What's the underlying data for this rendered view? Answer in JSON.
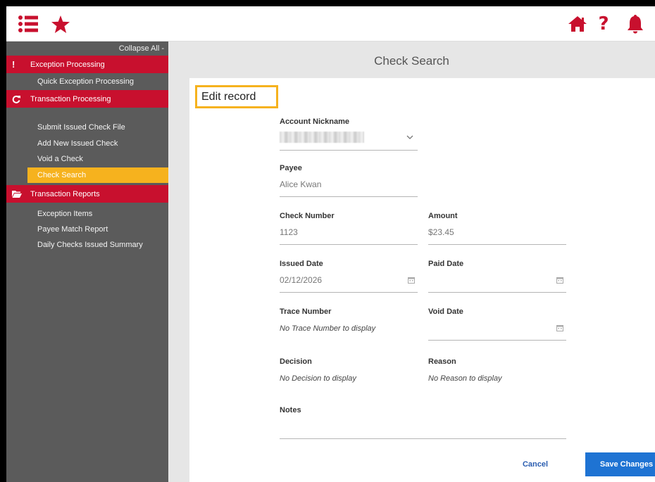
{
  "header": {
    "icons": [
      "menu-icon",
      "star-icon",
      "home-icon",
      "help-icon",
      "bell-icon"
    ],
    "help_glyph": "?"
  },
  "sidebar": {
    "collapse_all": "Collapse All -",
    "sections": [
      {
        "label": "Exception Processing",
        "icon": "exclamation-icon",
        "items": [
          "Quick Exception Processing"
        ]
      },
      {
        "label": "Transaction Processing",
        "icon": "refresh-icon",
        "items": [
          "Submit Issued Check File",
          "Add New Issued Check",
          "Void a Check",
          "Check Search"
        ]
      },
      {
        "label": "Transaction Reports",
        "icon": "folder-icon",
        "items": [
          "Exception Items",
          "Payee Match Report",
          "Daily Checks Issued Summary"
        ]
      }
    ],
    "active_item": "Check Search"
  },
  "main": {
    "page_title": "Check Search",
    "edit_record": "Edit record",
    "form": {
      "account_nickname": {
        "label": "Account Nickname",
        "value": ""
      },
      "payee": {
        "label": "Payee",
        "value": "Alice Kwan"
      },
      "check_number": {
        "label": "Check Number",
        "value": "1123"
      },
      "amount": {
        "label": "Amount",
        "value": "$23.45"
      },
      "issued_date": {
        "label": "Issued Date",
        "value": "02/12/2026"
      },
      "paid_date": {
        "label": "Paid Date",
        "value": ""
      },
      "trace_number": {
        "label": "Trace Number",
        "value": "No Trace Number to display"
      },
      "void_date": {
        "label": "Void Date",
        "value": ""
      },
      "decision": {
        "label": "Decision",
        "value": "No Decision to display"
      },
      "reason": {
        "label": "Reason",
        "value": "No Reason to display"
      },
      "notes": {
        "label": "Notes",
        "value": ""
      }
    },
    "buttons": {
      "cancel": "Cancel",
      "save": "Save Changes"
    }
  },
  "colors": {
    "brand_red": "#c8102e",
    "active_yellow": "#f6b21e",
    "sidebar_gray": "#5b5b5b",
    "primary_blue": "#1e73d3"
  }
}
